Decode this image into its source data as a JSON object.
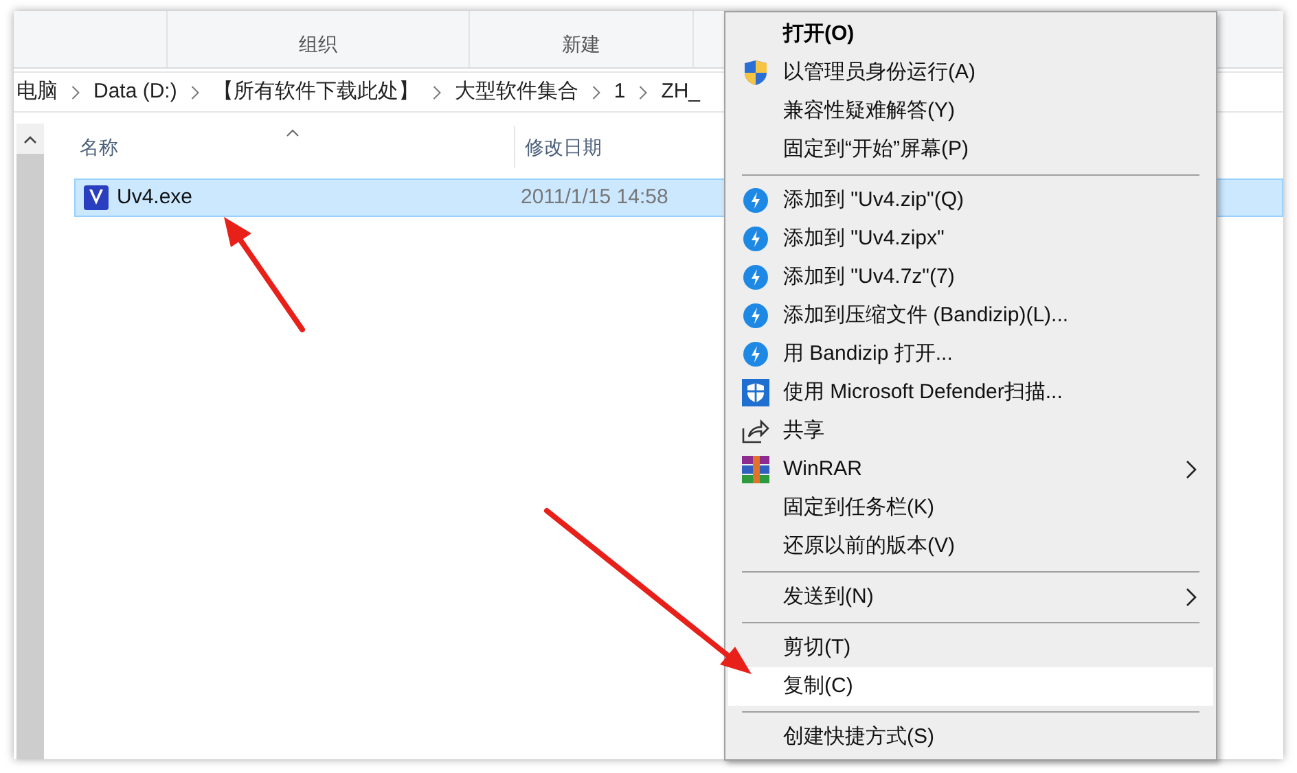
{
  "ribbon": {
    "groups": [
      "组织",
      "新建"
    ]
  },
  "breadcrumb": [
    "电脑",
    "Data (D:)",
    "【所有软件下载此处】",
    "大型软件集合",
    "1",
    "ZH_"
  ],
  "file_list": {
    "columns": [
      "名称",
      "修改日期"
    ],
    "rows": [
      {
        "name": "Uv4.exe",
        "modified": "2011/1/15 14:58",
        "selected": true
      }
    ]
  },
  "context_menu": {
    "items": [
      {
        "kind": "plain",
        "label": "打开(O)",
        "default": true,
        "submenu": false,
        "selected": false
      },
      {
        "kind": "shield",
        "label": "以管理员身份运行(A)",
        "default": false,
        "submenu": false,
        "selected": false
      },
      {
        "kind": "plain",
        "label": "兼容性疑难解答(Y)",
        "default": false,
        "submenu": false,
        "selected": false
      },
      {
        "kind": "plain",
        "label": "固定到“开始”屏幕(P)",
        "default": false,
        "submenu": false,
        "selected": false
      },
      {
        "kind": "separator"
      },
      {
        "kind": "bandizip",
        "label": "添加到 \"Uv4.zip\"(Q)",
        "default": false,
        "submenu": false,
        "selected": false
      },
      {
        "kind": "bandizip",
        "label": "添加到 \"Uv4.zipx\"",
        "default": false,
        "submenu": false,
        "selected": false
      },
      {
        "kind": "bandizip",
        "label": "添加到 \"Uv4.7z\"(7)",
        "default": false,
        "submenu": false,
        "selected": false
      },
      {
        "kind": "bandizip",
        "label": "添加到压缩文件 (Bandizip)(L)...",
        "default": false,
        "submenu": false,
        "selected": false
      },
      {
        "kind": "bandizip",
        "label": "用 Bandizip 打开...",
        "default": false,
        "submenu": false,
        "selected": false
      },
      {
        "kind": "defender",
        "label": "使用 Microsoft Defender扫描...",
        "default": false,
        "submenu": false,
        "selected": false
      },
      {
        "kind": "share",
        "label": "共享",
        "default": false,
        "submenu": false,
        "selected": false
      },
      {
        "kind": "winrar",
        "label": "WinRAR",
        "default": false,
        "submenu": true,
        "selected": false
      },
      {
        "kind": "plain",
        "label": "固定到任务栏(K)",
        "default": false,
        "submenu": false,
        "selected": false
      },
      {
        "kind": "plain",
        "label": "还原以前的版本(V)",
        "default": false,
        "submenu": false,
        "selected": false
      },
      {
        "kind": "separator"
      },
      {
        "kind": "plain",
        "label": "发送到(N)",
        "default": false,
        "submenu": true,
        "selected": false
      },
      {
        "kind": "separator"
      },
      {
        "kind": "plain",
        "label": "剪切(T)",
        "default": false,
        "submenu": false,
        "selected": false
      },
      {
        "kind": "plain",
        "label": "复制(C)",
        "default": false,
        "submenu": false,
        "selected": true
      },
      {
        "kind": "separator"
      },
      {
        "kind": "plain",
        "label": "创建快捷方式(S)",
        "default": false,
        "submenu": false,
        "selected": false
      }
    ]
  }
}
